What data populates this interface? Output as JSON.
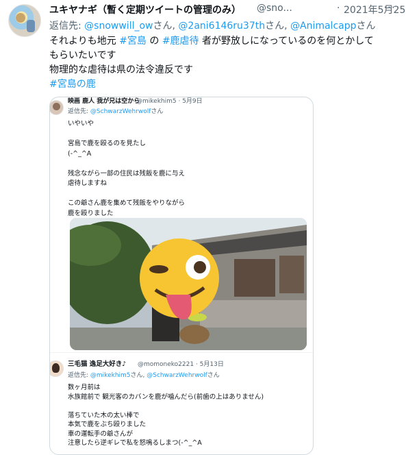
{
  "tweet": {
    "display_name": "ユキヤナギ（暫く定期ツイートの管理のみ）",
    "handle": "@sno...",
    "separator": "·",
    "date": "2021年5月25日",
    "more_label": "···",
    "reply_prefix": "返信先: ",
    "reply_to": [
      {
        "handle": "@snowwill_ow",
        "suffix": "さん, "
      },
      {
        "handle": "@2ani6146ru37th",
        "suffix": "さん, "
      },
      {
        "handle": "@Animalcapp",
        "suffix": "さん"
      }
    ],
    "text": {
      "line1_pre": "それよりも地元 ",
      "line1_tag1": "#宮島",
      "line1_mid": " の ",
      "line1_tag2": "#鹿虐待",
      "line1_post": " 者が野放しになっているのを何とかして",
      "line2": "もらいたいです",
      "line3": "物理的な虐待は県の法令違反です",
      "line4_tag": "#宮島の鹿"
    }
  },
  "quote": {
    "author_name": "映画 鹿人 我が兄は空から",
    "author_meta": "@mikekhim5 · 5月9日",
    "reply_prefix": "返信先: ",
    "reply_to": "@SchwarzWehrwolf",
    "reply_suffix": "さん",
    "lines": [
      "いやいや",
      "",
      "宮島で鹿を殴るのを見たし",
      "(-^_^A",
      "",
      "残念ながら一部の住民は残飯を鹿に与え",
      "虐待しますね",
      "",
      "この爺さん鹿を集めて残飯をやりながら",
      "鹿を殴りました"
    ],
    "photo_alt": "photo"
  },
  "quote2": {
    "author_name": "三毛猫 逸足大好き♪",
    "author_meta": "@momoneko2221 · 5月13日",
    "reply_prefix": "返信先: ",
    "reply_to_1": "@mikekhim5",
    "reply_mid": "さん, ",
    "reply_to_2": "@SchwarzWehrwolf",
    "reply_suffix": "さん",
    "lines": [
      "数ヶ月前は",
      "水族館前で 観光客のカバンを鹿が噛んだら(前歯の上はありません)",
      "",
      "落ちていた木の太い棒で",
      "本気で鹿をぶち殴りました",
      "車の運転手の爺さんが",
      "注意したら逆ギレで私を怒鳴るしまつ(-^_^A"
    ]
  },
  "colors": {
    "link": "#1d9bf0",
    "text": "#0f1419",
    "secondary": "#536471",
    "border": "#cfd9de"
  }
}
